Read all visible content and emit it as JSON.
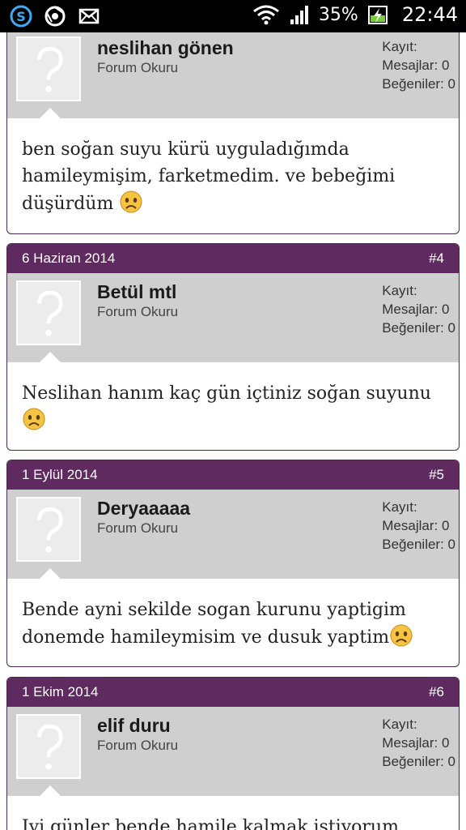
{
  "status_bar": {
    "battery": "35%",
    "time": "22:44",
    "icons": [
      "skype-icon",
      "chrome-icon",
      "mail-icon",
      "wifi-icon",
      "signal-icon",
      "battery-charging-icon"
    ]
  },
  "posts": [
    {
      "username": "neslihan gönen",
      "user_title": "Forum Okuru",
      "stats": {
        "kayit": "Kayıt:",
        "mesajlar": "Mesajlar: 0",
        "begeniler": "Beğeniler: 0"
      },
      "message": "ben soğan suyu kürü uyguladığımda hamileymişim, farketmedim. ve bebeğimi düşürdüm"
    },
    {
      "date": "6 Haziran 2014",
      "number": "#4",
      "username": "Betül mtl",
      "user_title": "Forum Okuru",
      "stats": {
        "kayit": "Kayıt:",
        "mesajlar": "Mesajlar: 0",
        "begeniler": "Beğeniler: 0"
      },
      "message": "Neslihan hanım kaç gün içtiniz soğan suyunu"
    },
    {
      "date": "1 Eylül 2014",
      "number": "#5",
      "username": "Deryaaaaa",
      "user_title": "Forum Okuru",
      "stats": {
        "kayit": "Kayıt:",
        "mesajlar": "Mesajlar: 0",
        "begeniler": "Beğeniler: 0"
      },
      "message": "Bende ayni sekilde sogan kurunu yaptigim donemde hamileymisim ve dusuk yaptim"
    },
    {
      "date": "1 Ekim 2014",
      "number": "#6",
      "username": "elif duru",
      "user_title": "Forum Okuru",
      "stats": {
        "kayit": "Kayıt:",
        "mesajlar": "Mesajlar: 0",
        "begeniler": "Beğeniler: 0"
      },
      "message": "Iyi günler bende hamile kalmak istiyorum"
    }
  ],
  "colors": {
    "header": "#5e2a5f",
    "userbar": "#cfcfcf",
    "border": "#4a2a55"
  }
}
